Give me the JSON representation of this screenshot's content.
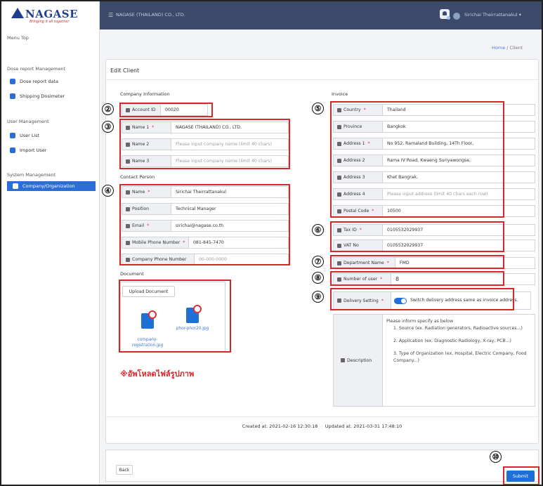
{
  "header": {
    "logo": "NAGASE",
    "tagline": "Bringing it all together",
    "company": "NAGASE (THAILAND) CO., LTD.",
    "user": "Sirichai Theirrattanakul ▾"
  },
  "sidebar": {
    "menu_top": "Menu Top",
    "groups": [
      {
        "title": "Dose report Management",
        "items": [
          "Dose report data",
          "Shipping Dosimeter"
        ]
      },
      {
        "title": "User Management",
        "items": [
          "User List",
          "Import User"
        ]
      },
      {
        "title": "System Management",
        "items": [
          "Company/Organization"
        ]
      }
    ]
  },
  "breadcrumb": {
    "home": "Home",
    "sep": " / ",
    "current": "Client"
  },
  "form": {
    "title": "Edit Client",
    "company_section": "Company Information",
    "account_id_label": "Account ID",
    "account_id": "00020",
    "name1_label": "Name 1",
    "name1": "NAGASE (THAILAND) CO., LTD.",
    "name2_label": "Name 2",
    "name2_ph": "Please input company name (limit 40 chars)",
    "name3_label": "Name 3",
    "name3_ph": "Please input company name (limit 40 chars)",
    "contact_section": "Contact Person",
    "cname_label": "Name",
    "cname": "Sirichai Theirrattanakul",
    "position_label": "Position",
    "position": "Technical Manager",
    "email_label": "Email",
    "email": "sirichai@nagase.co.th",
    "mobile_label": "Mobile Phone Number",
    "mobile": "081-845-7470",
    "cphone_label": "Company Phone Number",
    "cphone_ph": "00-000-0000",
    "document_section": "Document",
    "upload_label": "Upload Document",
    "files": [
      "company-\nregistration.jpg",
      "phor-phor20.jpg"
    ],
    "thai_note": "※อัพโหลดไฟล์รูปภาพ",
    "invoice_section": "Invoice",
    "country_label": "Country",
    "country": "Thailand",
    "province_label": "Province",
    "province": "Bangkok",
    "addr1_label": "Address 1",
    "addr1": "No 952, Ramaland Building, 14Th Floor,",
    "addr2_label": "Address 2",
    "addr2": "Rama IV Road, Kwaeng Suriyawongse,",
    "addr3_label": "Address 3",
    "addr3": "Khet Bangrak,",
    "addr4_label": "Address 4",
    "addr4_ph": "Please input address (limit 40 chars each row)",
    "postal_label": "Postal Code",
    "postal": "10500",
    "tax_label": "Tax ID",
    "tax": "0105532029937",
    "vat_label": "VAT No",
    "vat": "0105532029937",
    "dept_label": "Department Name",
    "dept": "FMD",
    "users_label": "Number of user",
    "users": "8",
    "delivery_label": "Delivery Setting",
    "delivery": "Switch delivery address same as invoice address.",
    "desc_label": "Description",
    "desc_lines": [
      "Please inform specify as below",
      "1. Source (ex. Radiation generators, Radioactive sources...)",
      "2. Application (ex. Diagnostic Radiology, X-ray, PCB...)",
      "3. Type of Organization (ex. Hospital, Electric Company, Food Company...)"
    ],
    "created": "Created at: 2021-02-16 12:30:18",
    "updated": "Updated at: 2021-03-31 17:48:10"
  },
  "markers": [
    "②",
    "③",
    "④",
    "⑤",
    "⑥",
    "⑦",
    "⑧",
    "⑨",
    "⑩"
  ],
  "buttons": {
    "back": "Back",
    "submit": "Submit"
  },
  "colors": {
    "accent": "#1e6fd6",
    "topbar": "#3a4a68",
    "annotation": "#d62828"
  }
}
